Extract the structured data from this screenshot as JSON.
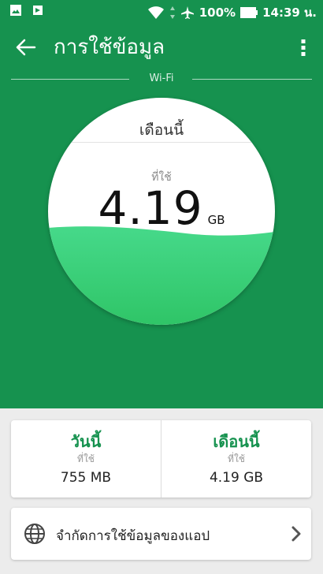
{
  "status_bar": {
    "battery": "100%",
    "time": "14:39 น.",
    "icons": [
      "image-icon",
      "play-store-icon",
      "wifi-icon",
      "data-arrows-icon",
      "airplane-icon",
      "battery-icon"
    ]
  },
  "app_bar": {
    "title": "การใช้ข้อมูล",
    "icons": [
      "back-arrow-icon",
      "more-vert-icon"
    ]
  },
  "network": {
    "label": "Wi-Fi"
  },
  "usage_circle": {
    "period": "เดือนนี้",
    "used_label": "ที่ใช้",
    "value": "4.19",
    "unit": "GB"
  },
  "stats": [
    {
      "title": "วันนี้",
      "sub": "ที่ใช้",
      "value": "755 MB"
    },
    {
      "title": "เดือนนี้",
      "sub": "ที่ใช้",
      "value": "4.19 GB"
    }
  ],
  "limit_row": {
    "label": "จำกัดการใช้ข้อมูลของแอป",
    "icon": "globe-icon"
  },
  "colors": {
    "primary": "#16924f",
    "wave": "#3ccb77",
    "background": "#ececec"
  }
}
